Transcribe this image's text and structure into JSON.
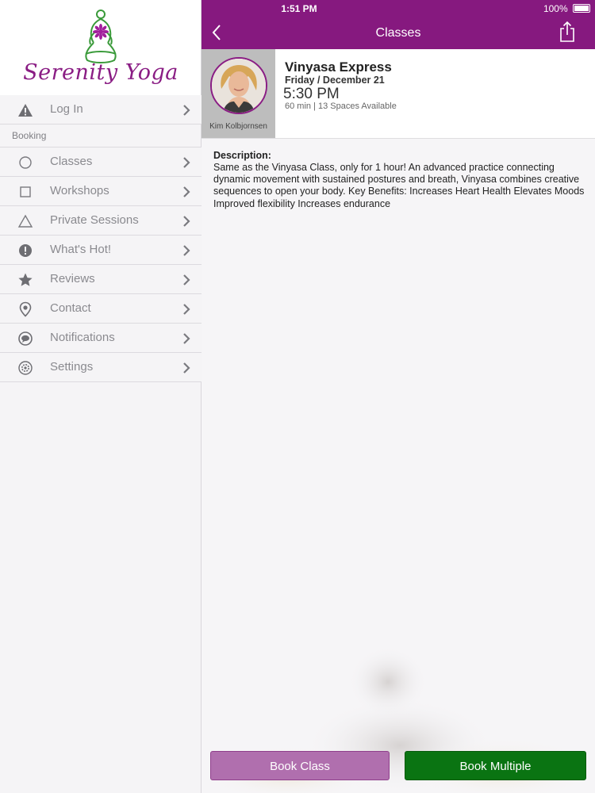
{
  "app": {
    "name": "Serenity Yoga"
  },
  "status_bar": {
    "time": "1:51 PM",
    "battery": "100%"
  },
  "nav": {
    "title": "Classes"
  },
  "sidebar": {
    "login_label": "Log In",
    "section_label": "Booking",
    "items": [
      {
        "label": "Classes",
        "icon": "circle-icon"
      },
      {
        "label": "Workshops",
        "icon": "square-icon"
      },
      {
        "label": "Private Sessions",
        "icon": "triangle-icon"
      },
      {
        "label": "What's Hot!",
        "icon": "exclamation-icon"
      },
      {
        "label": "Reviews",
        "icon": "star-icon"
      },
      {
        "label": "Contact",
        "icon": "location-pin-icon"
      },
      {
        "label": "Notifications",
        "icon": "chat-bubble-icon"
      },
      {
        "label": "Settings",
        "icon": "gear-icon"
      }
    ]
  },
  "class_detail": {
    "name": "Vinyasa Express",
    "date": "Friday / December 21",
    "time": "5:30 PM",
    "meta": "60 min | 13 Spaces Available",
    "instructor": "Kim Kolbjornsen",
    "description_label": "Description:",
    "description": "Same as the Vinyasa Class, only for 1 hour!   An advanced practice connecting dynamic movement with sustained postures and breath, Vinyasa combines creative sequences to open your body. Key Benefits: Increases Heart Health Elevates Moods Improved flexibility Increases endurance"
  },
  "actions": {
    "book_class": "Book Class",
    "book_multiple": "Book Multiple"
  },
  "colors": {
    "brand_purple": "#86197f",
    "book_class": "#b06fae",
    "book_multiple": "#0a7412"
  }
}
